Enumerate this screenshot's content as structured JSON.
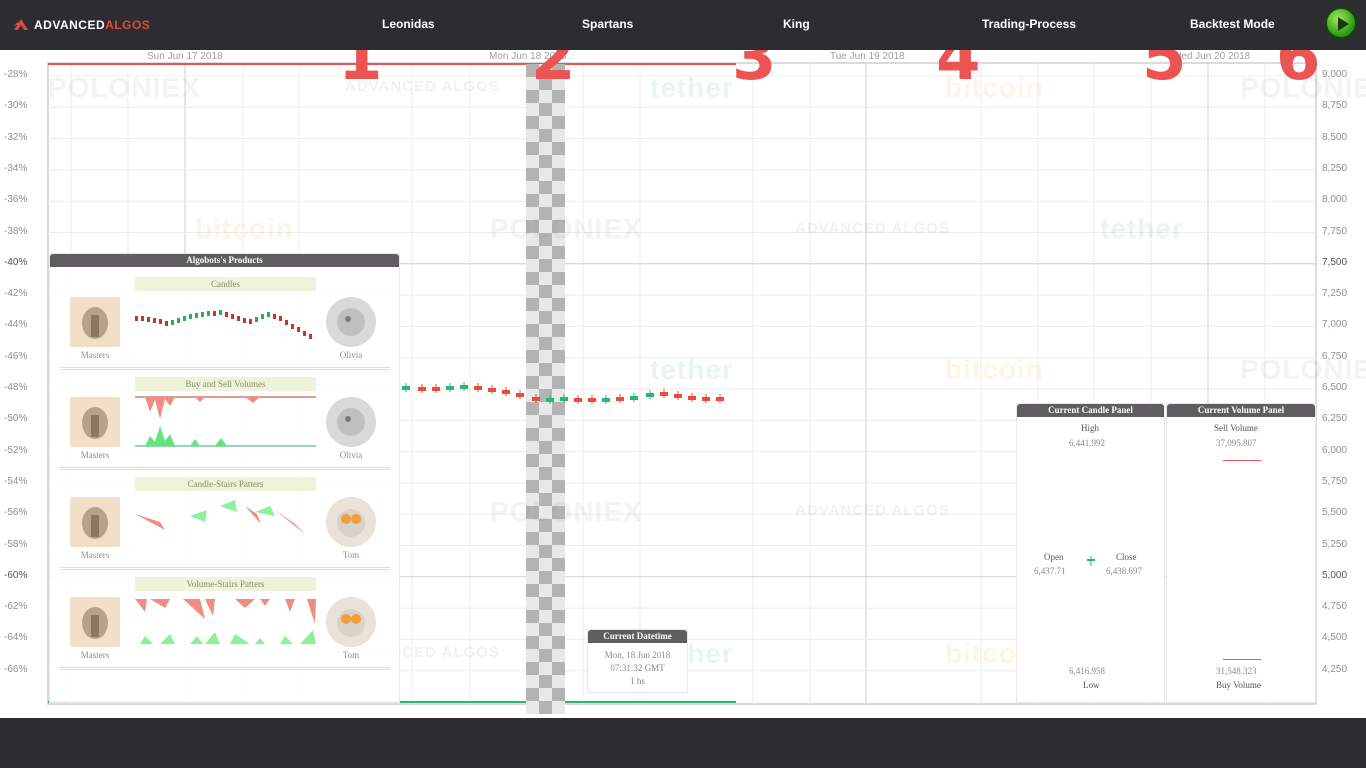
{
  "header": {
    "logo_left": "ADVANCED",
    "logo_right": "ALGOS",
    "tabs": [
      "Leonidas",
      "Spartans",
      "King",
      "Trading-Process",
      "Backtest Mode"
    ],
    "play_icon": "play-icon",
    "tab_numbers": [
      "1",
      "2",
      "3",
      "4",
      "5",
      "6"
    ]
  },
  "timeline": {
    "dates": [
      "Sun Jun 17 2018",
      "Mon Jun 18 2018",
      "Tue Jun 19 2018",
      "Wed Jun 20 2018"
    ]
  },
  "axes": {
    "left": [
      "-28%",
      "-30%",
      "-32%",
      "-34%",
      "-36%",
      "-38%",
      "-40%",
      "-42%",
      "-44%",
      "-46%",
      "-48%",
      "-50%",
      "-52%",
      "-54%",
      "-56%",
      "-58%",
      "-60%",
      "-62%",
      "-64%",
      "-66%"
    ],
    "right": [
      "9,000",
      "8,750",
      "8,500",
      "8,250",
      "8,000",
      "7,750",
      "7,500",
      "7,250",
      "7,000",
      "6,750",
      "6,500",
      "6,250",
      "6,000",
      "5,750",
      "5,500",
      "5,250",
      "5,000",
      "4,750",
      "4,500",
      "4,250"
    ]
  },
  "watermarks": [
    "POLONIEX",
    "ADVANCED ALGOS",
    "tether",
    "bitcoin"
  ],
  "products_panel": {
    "title": "Algobots's Products",
    "products": [
      {
        "label": "Candles",
        "left_name": "Masters",
        "right_name": "Olivia"
      },
      {
        "label": "Buy and Sell Volumes",
        "left_name": "Masters",
        "right_name": "Olivia"
      },
      {
        "label": "Candle-Stairs Patters",
        "left_name": "Masters",
        "right_name": "Tom"
      },
      {
        "label": "Volume-Stairs Patters",
        "left_name": "Masters",
        "right_name": "Tom"
      }
    ]
  },
  "datetime_panel": {
    "title": "Current Datetime",
    "line1": "Mon, 18 Jun 2018",
    "line2": "07:31:32 GMT",
    "line3": "1 hs"
  },
  "candle_panel": {
    "title": "Current Candle Panel",
    "high_label": "High",
    "high_value": "6,441.992",
    "open_label": "Open",
    "open_value": "6,437.71",
    "close_label": "Close",
    "close_value": "6,438.697",
    "low_label": "Low",
    "low_value": "6,416.958"
  },
  "volume_panel": {
    "title": "Current Volume Panel",
    "sell_label": "Sell Volume",
    "sell_value": "37,095.807",
    "buy_label": "Buy Volume",
    "buy_value": "31,548.323"
  },
  "colors": {
    "background": "#2d2c31",
    "accent_red": "#ec5454",
    "candle_up": "#2bb673",
    "candle_down": "#e74c3c"
  }
}
